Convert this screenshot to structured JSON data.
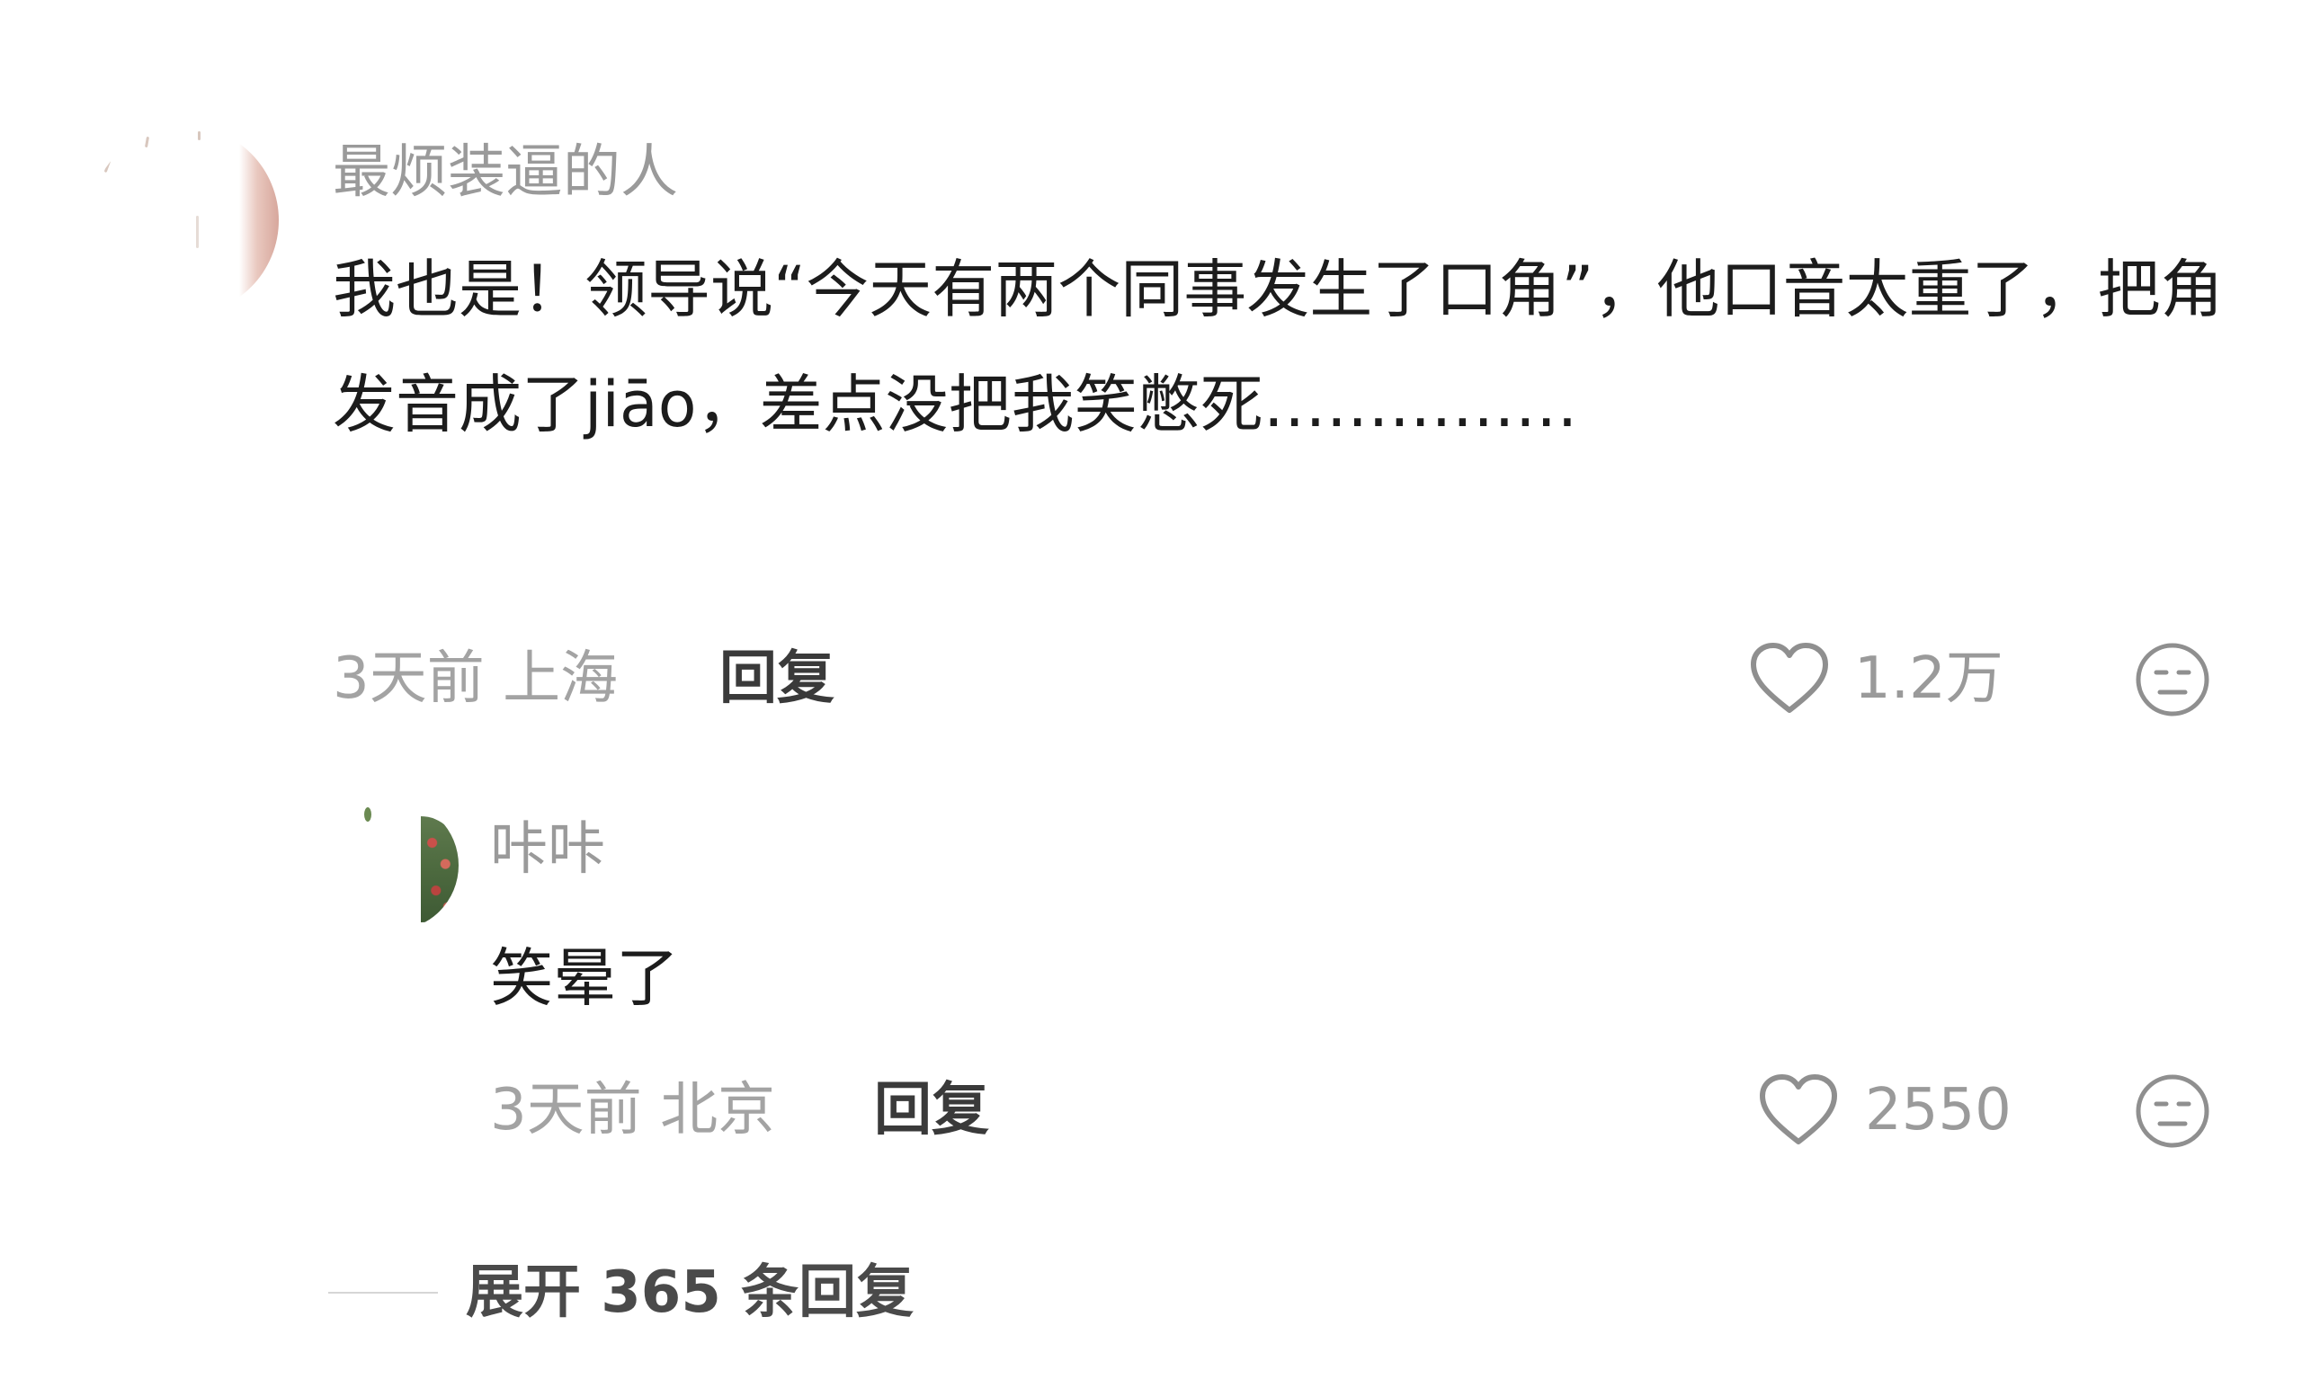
{
  "comment": {
    "username": "最烦装逼的人",
    "text": "我也是！领导说“今天有两个同事发生了口角”，他口音太重了，把角发音成了jiāo，差点没把我笑憋死……………",
    "time": "3天前",
    "location": "上海",
    "reply_label": "回复",
    "likes": "1.2万",
    "like_icon": "heart-icon",
    "reaction_icon": "neutral-face-icon"
  },
  "reply": {
    "username": "咔咔",
    "text": "笑晕了",
    "time": "3天前",
    "location": "北京",
    "reply_label": "回复",
    "likes": "2550",
    "like_icon": "heart-icon",
    "reaction_icon": "neutral-face-icon"
  },
  "expand": {
    "label": "展开 365 条回复"
  },
  "colors": {
    "meta_gray": "#a3a3a3",
    "text_dark": "#1c1c1c",
    "reply_label": "#3a3a3a"
  }
}
